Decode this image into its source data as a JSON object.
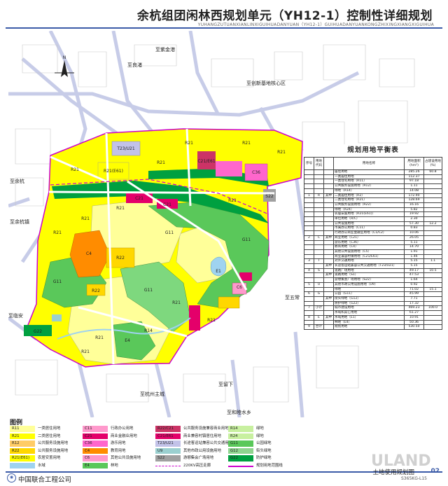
{
  "header": {
    "title": "余杭组团闲林西规划单元（YH12-1）控制性详细规划",
    "subtitle": "YUHANGZUTUANXIANLINXIGUIHUADANYUAN（YH12-1）GUIHUADANYUANKONGZHIXINGXIANGXIGUIHUA"
  },
  "map": {
    "place_labels": [
      "至良渚",
      "至紫金港",
      "至余杭",
      "至创新基地核心区",
      "至余杭镇",
      "至五常",
      "至临安",
      "至杭州主城",
      "至留下",
      "至和睦水乡"
    ],
    "zone_codes": [
      "R21",
      "R22",
      "R11",
      "R12",
      "C21",
      "C22",
      "C36",
      "C4",
      "C5",
      "C6",
      "C11",
      "S22",
      "T23/U21",
      "G11",
      "G12",
      "G22",
      "E1",
      "E4",
      "R14",
      "R24",
      "R21(E61)"
    ],
    "colors": {
      "R11": "#ffff99",
      "R21": "#ffff00",
      "R22": "#ffd700",
      "R12": "#ffcc66",
      "C4": "#ff8c00",
      "C11": "#ff99cc",
      "C21": "#e4006a",
      "C36": "#ff66cc",
      "C22": "#cc3366",
      "C6": "#ff99cc",
      "T23": "#c2c2e8",
      "S22": "#a0a0a0",
      "G11": "#5ac85a",
      "G12": "#8fd48f",
      "G22": "#00a040",
      "E1": "#bfe2ff",
      "E4": "#a8e6a8",
      "water": "#9fd3f0",
      "R21E61": "#ffff00"
    }
  },
  "table": {
    "title": "规划用地平衡表",
    "headers": [
      "序号",
      "用地代码",
      "",
      "用地名称",
      "用地面积(hm²)",
      "占建设用地(%)"
    ],
    "rows": [
      [
        "",
        "",
        "",
        "居住用地",
        "285.26",
        "60.8"
      ],
      [
        "",
        "",
        "",
        "一类居住用地",
        "112.37",
        ""
      ],
      [
        "",
        "",
        "",
        "一类住宅用地（R11）",
        "97.18",
        ""
      ],
      [
        "",
        "",
        "",
        "公共服务设施用地（R12）",
        "1.11",
        ""
      ],
      [
        "",
        "",
        "",
        "绿地（R14）",
        "14.08",
        ""
      ],
      [
        "1",
        "R",
        "其中",
        "二类居住用地（R2）",
        "172.90",
        ""
      ],
      [
        "",
        "",
        "",
        "二类住宅用地（R21）",
        "128.69",
        ""
      ],
      [
        "",
        "",
        "",
        "公共服务设施用地（R22）",
        "16.16",
        ""
      ],
      [
        "",
        "",
        "",
        "绿地（R24）",
        "5.82",
        ""
      ],
      [
        "",
        "",
        "",
        "农居安置用地（R21(E61)）",
        "19.92",
        ""
      ],
      [
        "",
        "",
        "",
        "单位用地（R/C）",
        "2.30",
        ""
      ],
      [
        "",
        "",
        "",
        "公共设施用地",
        "57.30",
        "12.2"
      ],
      [
        "",
        "",
        "",
        "市属办公用地（C11）",
        "0.83",
        ""
      ],
      [
        "",
        "",
        "",
        "行政办公商业金融业用地（C1/C2）",
        "10.06",
        ""
      ],
      [
        "2",
        "C",
        "其中",
        "商业用地（C21）",
        "26.05",
        ""
      ],
      [
        "",
        "",
        "",
        "游乐用地（C36）",
        "5.11",
        ""
      ],
      [
        "",
        "",
        "",
        "教育用地（C4）",
        "14.70",
        ""
      ],
      [
        "",
        "",
        "",
        "其他公共设施用地（C5）",
        "1.91",
        ""
      ],
      [
        "",
        "",
        "",
        "商业兼容村镇用地（C21/E61）",
        "1.46",
        ""
      ],
      [
        "3",
        "T",
        "",
        "对外交通用地",
        "5.15",
        "1.1"
      ],
      [
        "",
        "",
        "其中",
        "长途客运站兼容公共交通用地（T23/U21）",
        "5.15",
        ""
      ],
      [
        "4",
        "S",
        "",
        "道路广场用地",
        "49.17",
        "10.5"
      ],
      [
        "",
        "",
        "其中",
        "道路用地（S1）",
        "47.53",
        ""
      ],
      [
        "",
        "",
        "",
        "游憩集会广场用地（S22）",
        "1.64",
        ""
      ],
      [
        "5",
        "U",
        "",
        "其他市政公用设施用地（U9）",
        "0.92",
        ""
      ],
      [
        "",
        "",
        "",
        "绿地",
        "71.02",
        "15.1"
      ],
      [
        "6",
        "G",
        "",
        "公园（G11）",
        "45.99",
        ""
      ],
      [
        "",
        "",
        "其中",
        "街头绿地（G12）",
        "7.71",
        ""
      ],
      [
        "",
        "",
        "",
        "防护绿地（G22）",
        "17.32",
        ""
      ],
      [
        "7",
        "小计",
        "",
        "城市建设用地",
        "469.23",
        "100.0"
      ],
      [
        "",
        "",
        "",
        "水域和其它用地",
        "61.27",
        ""
      ],
      [
        "8",
        "E",
        "其中",
        "水域用地（E1）",
        "10.91",
        ""
      ],
      [
        "",
        "",
        "",
        "林地（E4）",
        "50.36",
        ""
      ],
      [
        "9",
        "合计",
        "",
        "规划用地",
        "530.50",
        ""
      ]
    ]
  },
  "legend": {
    "title": "图例",
    "items": [
      {
        "code": "R11",
        "label": "一类居住用地",
        "color": "#ffff99"
      },
      {
        "code": "C11",
        "label": "行政办公用地",
        "color": "#ff99cc"
      },
      {
        "code": "R22/C21",
        "label": "公共服务设施兼容商业用地",
        "color": "#cc3366"
      },
      {
        "code": "R14",
        "label": "绿地",
        "color": "#c8f0a0"
      },
      {
        "code": "R21",
        "label": "二类居住用地",
        "color": "#ffff00"
      },
      {
        "code": "C21",
        "label": "商业金融业用地",
        "color": "#e4006a"
      },
      {
        "code": "C21/E61",
        "label": "商业兼容村镇居住用地",
        "color": "#e4006a"
      },
      {
        "code": "R24",
        "label": "绿地",
        "color": "#c8f0a0"
      },
      {
        "code": "R12",
        "label": "公共服务设施用地",
        "color": "#ffcc66"
      },
      {
        "code": "C36",
        "label": "游乐用地",
        "color": "#ff66cc"
      },
      {
        "code": "T23/U21",
        "label": "长途客运站兼容公共交通用地",
        "color": "#c2c2e8"
      },
      {
        "code": "G11",
        "label": "公园绿地",
        "color": "#5ac85a"
      },
      {
        "code": "R22",
        "label": "公共服务设施用地",
        "color": "#ffd700"
      },
      {
        "code": "C4",
        "label": "教育用地",
        "color": "#ff8c00"
      },
      {
        "code": "U9",
        "label": "其他市政公用设施用地",
        "color": "#9bd0d0"
      },
      {
        "code": "G12",
        "label": "街头绿地",
        "color": "#8fd48f"
      },
      {
        "code": "R21(E61)",
        "label": "农居安置用地",
        "color": "#ffff00"
      },
      {
        "code": "C6",
        "label": "其他公共设施用地",
        "color": "#ff99cc"
      },
      {
        "code": "S22",
        "label": "游憩集会广场用地",
        "color": "#a0a0a0"
      },
      {
        "code": "G22",
        "label": "防护绿地",
        "color": "#00a040"
      },
      {
        "code": "",
        "label": "水域",
        "color": "#9fd3f0"
      },
      {
        "code": "E4",
        "label": "林地",
        "color": "#5ac85a"
      },
      {
        "code": "",
        "label": "220KV高压走廊",
        "color": "#cc00cc"
      },
      {
        "code": "",
        "label": "规划用地范围线",
        "color": "#cc00cc"
      }
    ]
  },
  "footer": {
    "company": "中国联合工程公司",
    "map_name": "土地使用规划图",
    "map_code": "S365KG-L15",
    "page_no": "02",
    "watermark": "ULAND"
  }
}
